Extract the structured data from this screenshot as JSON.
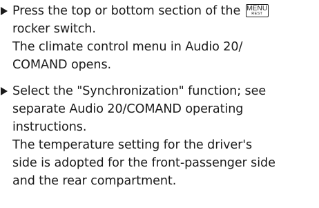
{
  "steps": [
    {
      "instruction_lines": [
        "Press the top or bottom section of the",
        "rocker switch."
      ],
      "key": {
        "label": "MENU",
        "sublabel": "REST"
      },
      "result_lines": [
        "The climate control menu in Audio 20/",
        "COMAND opens."
      ]
    },
    {
      "instruction_lines": [
        "Select the \"Synchronization\" function; see",
        "separate Audio 20/COMAND operating",
        "instructions."
      ],
      "result_lines": [
        "The temperature setting for the driver's",
        "side is adopted for the front-passenger side",
        "and the rear compartment."
      ]
    }
  ]
}
